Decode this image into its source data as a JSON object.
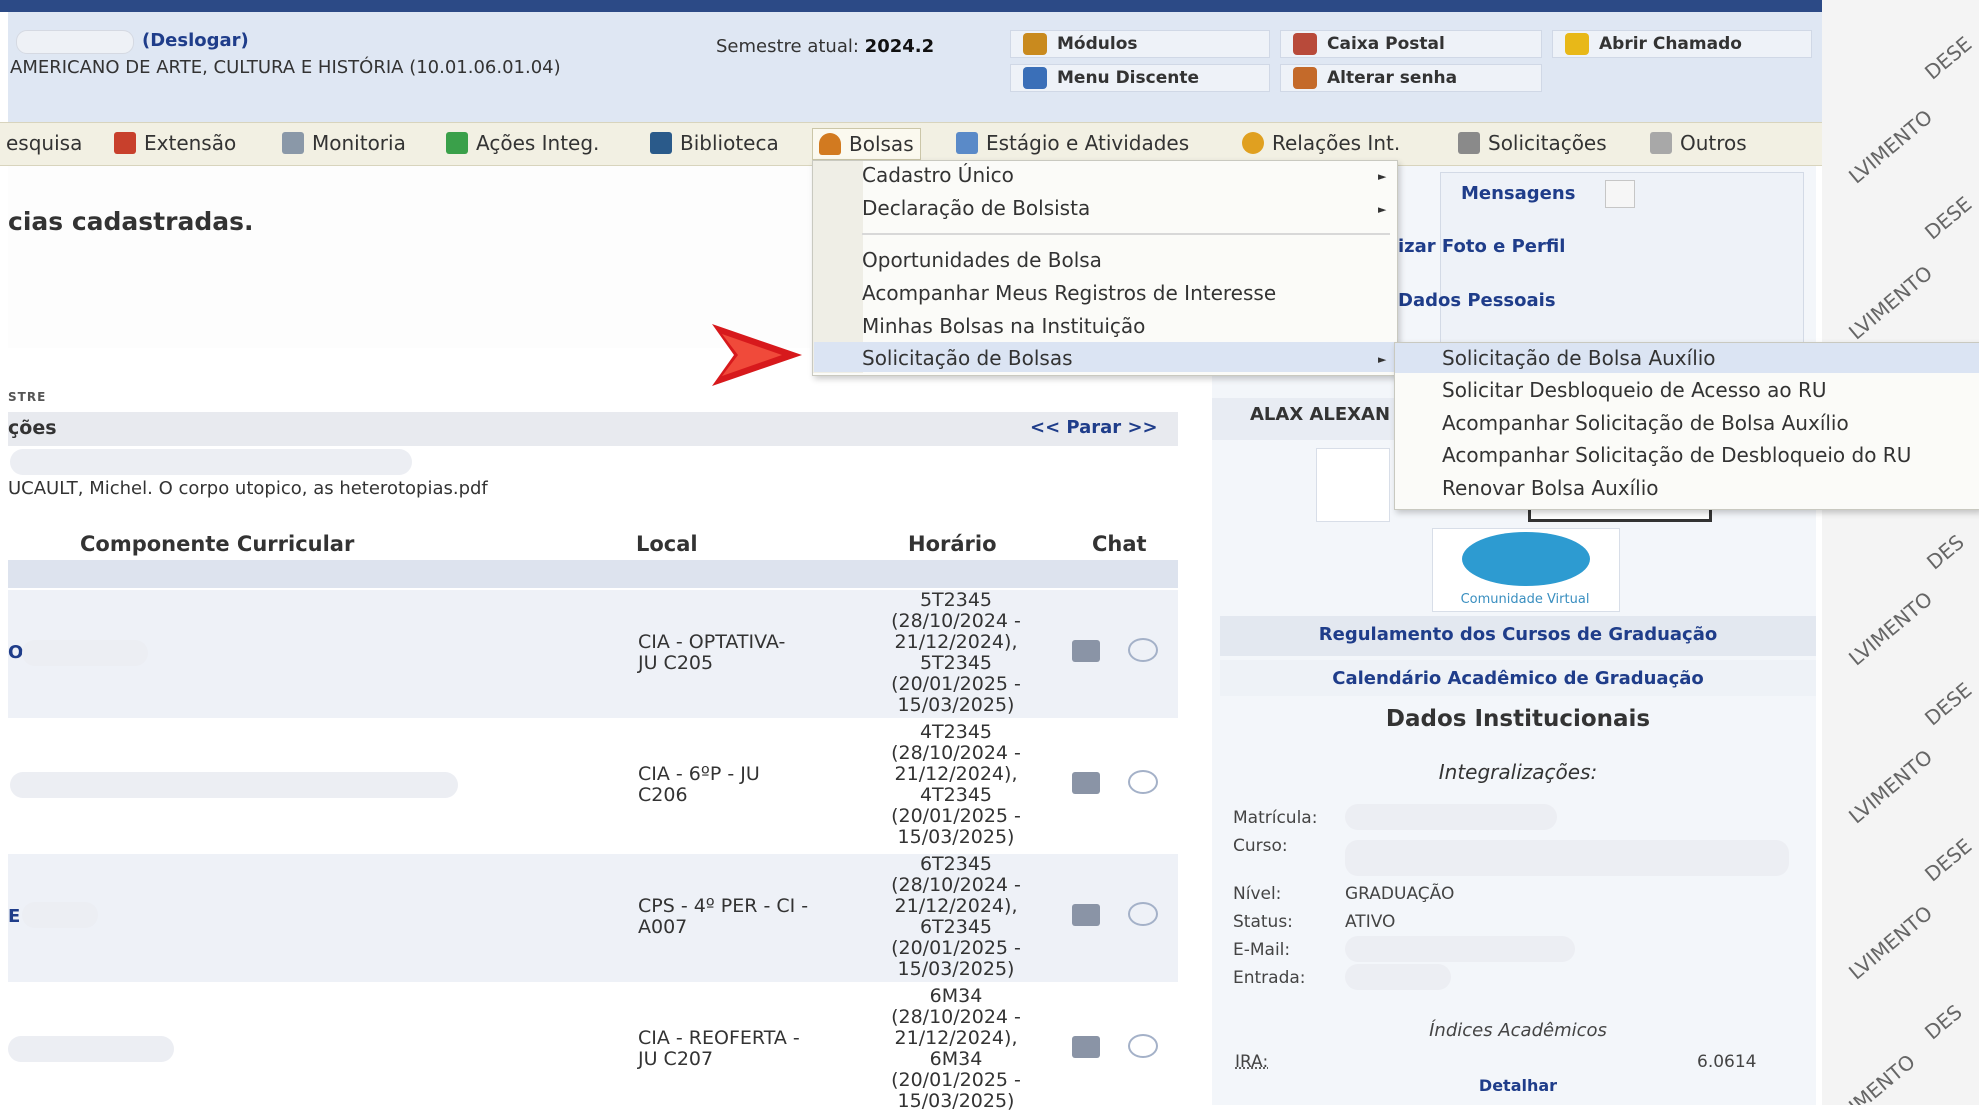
{
  "header": {
    "deslogar": "(Deslogar)",
    "unidade": "AMERICANO DE ARTE, CULTURA E HISTÓRIA (10.01.06.01.04)",
    "semestre_label": "Semestre atual:",
    "semestre_value": "2024.2",
    "buttons": [
      {
        "label": "Módulos",
        "icon": "modules-icon"
      },
      {
        "label": "Caixa Postal",
        "icon": "mailbox-icon"
      },
      {
        "label": "Abrir Chamado",
        "icon": "ticket-icon"
      },
      {
        "label": "Menu Discente",
        "icon": "student-menu-icon"
      },
      {
        "label": "Alterar senha",
        "icon": "key-icon"
      }
    ]
  },
  "menubar": [
    {
      "label": "esquisa",
      "icon": "research-icon"
    },
    {
      "label": "Extensão",
      "icon": "extension-icon"
    },
    {
      "label": "Monitoria",
      "icon": "monitor-icon"
    },
    {
      "label": "Ações Integ.",
      "icon": "integrated-actions-icon"
    },
    {
      "label": "Biblioteca",
      "icon": "library-icon"
    },
    {
      "label": "Bolsas",
      "icon": "user-icon"
    },
    {
      "label": "Estágio e Atividades",
      "icon": "internship-icon"
    },
    {
      "label": "Relações Int.",
      "icon": "globe-icon"
    },
    {
      "label": "Solicitações",
      "icon": "requests-icon"
    },
    {
      "label": "Outros",
      "icon": "others-icon"
    }
  ],
  "dropdown": {
    "items": [
      "Cadastro Único",
      "Declaração de Bolsista",
      "Oportunidades de Bolsa",
      "Acompanhar Meus Registros de Interesse",
      "Minhas Bolsas na Instituição",
      "Solicitação de Bolsas"
    ],
    "submenu": [
      "Solicitação de Bolsa Auxílio",
      "Solicitar Desbloqueio de Acesso ao RU",
      "Acompanhar Solicitação de Bolsa Auxílio",
      "Acompanhar Solicitação de Desbloqueio do RU",
      "Renovar Bolsa Auxílio"
    ]
  },
  "main": {
    "message": "cias cadastradas.",
    "stre": "STRE",
    "list_title": "ções",
    "parar": "<< Parar >>",
    "file": "UCAULT, Michel. O corpo utopico, as heterotopias.pdf",
    "columns": [
      "Componente Curricular",
      "Local",
      "Horário",
      "Chat"
    ],
    "rows": [
      {
        "prefix": "O",
        "local": [
          "CIA - OPTATIVA-",
          "JU C205"
        ],
        "horario": [
          "5T2345",
          "(28/10/2024 -",
          "21/12/2024),",
          "5T2345",
          "(20/01/2025 -",
          "15/03/2025)"
        ]
      },
      {
        "prefix": "",
        "local": [
          "CIA - 6ºP - JU",
          "C206"
        ],
        "horario": [
          "4T2345",
          "(28/10/2024 -",
          "21/12/2024),",
          "4T2345",
          "(20/01/2025 -",
          "15/03/2025)"
        ]
      },
      {
        "prefix": "E",
        "local": [
          "CPS - 4º PER - CI -",
          "A007"
        ],
        "horario": [
          "6T2345",
          "(28/10/2024 -",
          "21/12/2024),",
          "6T2345",
          "(20/01/2025 -",
          "15/03/2025)"
        ]
      },
      {
        "prefix": "",
        "local": [
          "CIA - REOFERTA -",
          "JU C207"
        ],
        "horario": [
          "6M34",
          "(28/10/2024 -",
          "21/12/2024),",
          "6M34",
          "(20/01/2025 -",
          "15/03/2025)"
        ]
      }
    ]
  },
  "right": {
    "mensagens": "Mensagens",
    "foto": "izar Foto e Perfil",
    "dados_pessoais": "Dados Pessoais",
    "name": "ALAX ALEXAN",
    "comunidade": "Comunidade Virtual",
    "regulamento": "Regulamento dos Cursos de Graduação",
    "calendario": "Calendário Acadêmico de Graduação",
    "dados_title": "Dados Institucionais",
    "integ": "Integralizações:",
    "labels": [
      "Matrícula:",
      "Curso:",
      "Nível:",
      "Status:",
      "E-Mail:",
      "Entrada:"
    ],
    "nivel": "GRADUAÇÃO",
    "status": "ATIVO",
    "indices": "Índices Acadêmicos",
    "ira_label": "IRA:",
    "ira_value": "6.0614",
    "detalhar": "Detalhar"
  },
  "watermark": [
    "DESE",
    "LVIMENTO",
    "DESE",
    "LVIMENTO",
    "DES",
    "LVIMENTO",
    "DESE",
    "LVIMENTO",
    "DESE",
    "LVIMENTO",
    "DES",
    "IMENTO"
  ],
  "colors": {
    "link": "#1f3d8a",
    "header_bg": "#dfe7f3",
    "menubar_bg": "#f2f0e3",
    "highlight": "#dbe4f3",
    "arrow": "#d7191c"
  }
}
